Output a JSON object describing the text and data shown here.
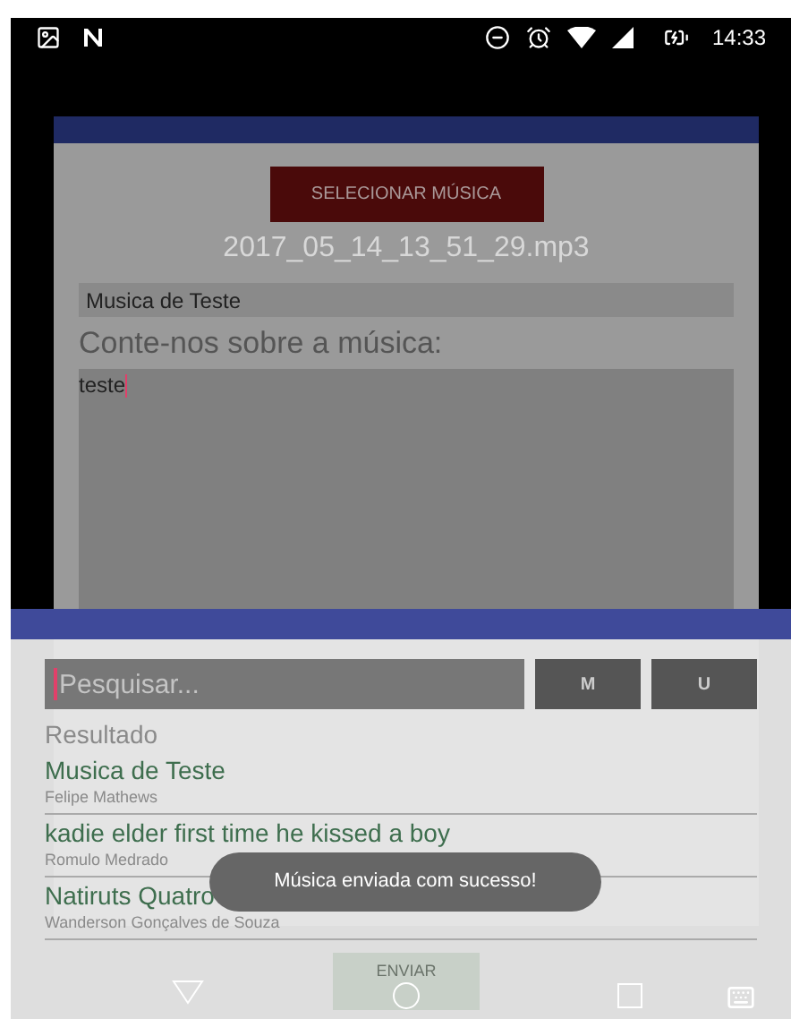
{
  "status_bar": {
    "time": "14:33"
  },
  "dialog": {
    "select_button": "SELECIONAR MÚSICA",
    "file_name": "2017_05_14_13_51_29.mp3",
    "title_field": {
      "value": "Musica de Teste"
    },
    "description_label": "Conte-nos sobre a música:",
    "description_field": {
      "value": "teste"
    },
    "send_button": "ENVIAR"
  },
  "search_panel": {
    "search_field": {
      "placeholder": "Pesquisar..."
    },
    "buttons": [
      "M",
      "U"
    ],
    "results_label": "Resultado",
    "results": [
      {
        "title": "Musica de Teste",
        "artist": "Felipe Mathews"
      },
      {
        "title": "kadie elder first time he kissed a boy",
        "artist": "Romulo Medrado"
      },
      {
        "title": "Natiruts Quatro",
        "artist": "Wanderson Gonçalves de Souza"
      }
    ]
  },
  "toast": "Música enviada com sucesso!"
}
